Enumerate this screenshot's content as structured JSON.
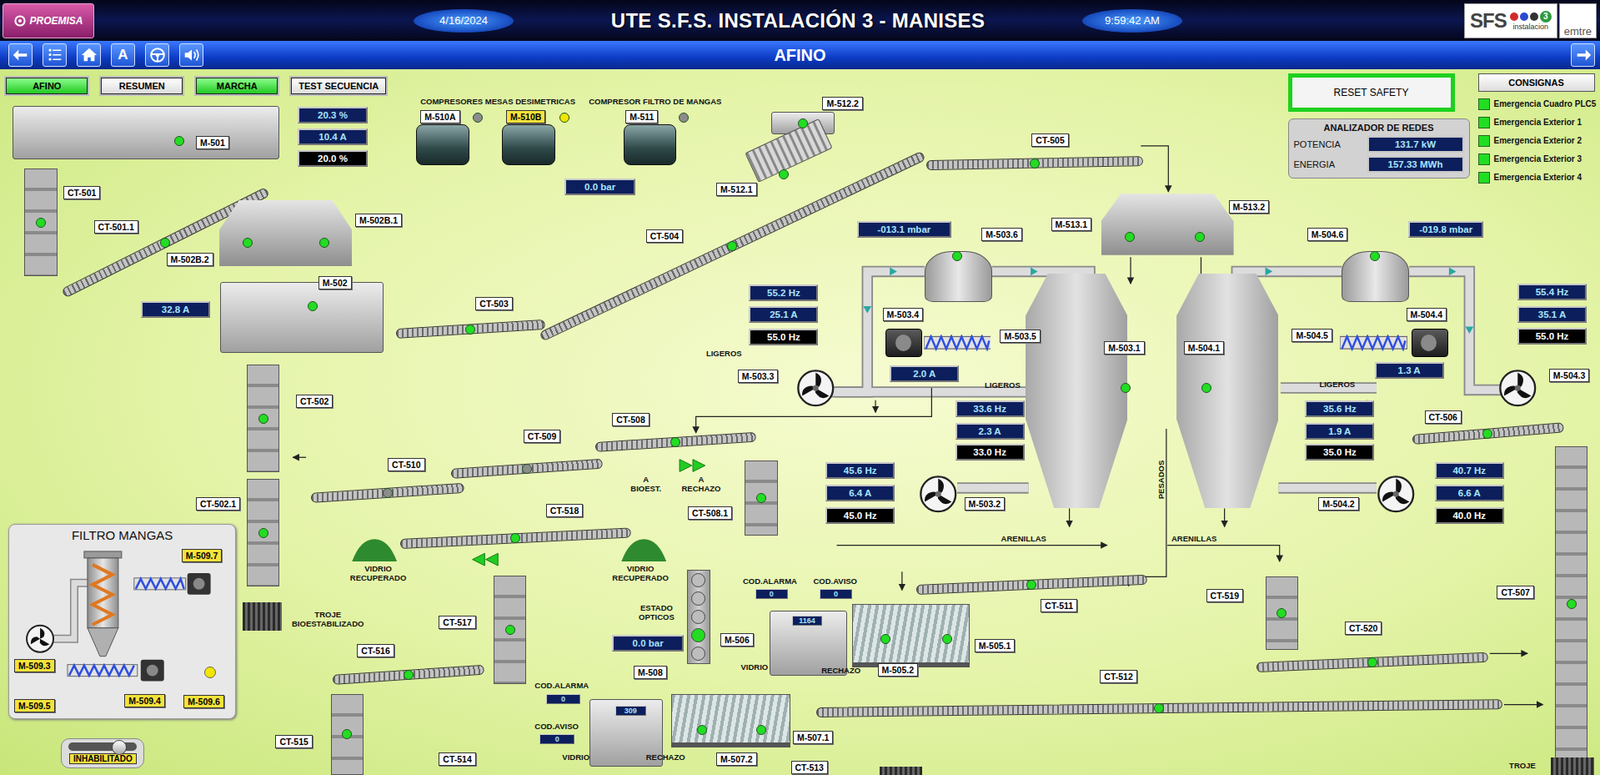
{
  "header": {
    "logo": "PROEMISA",
    "date": "4/16/2024",
    "title": "UTE S.F.S. INSTALACIÓN 3 - MANISES",
    "time": "9:59:42 AM",
    "brand": {
      "name": "SFS",
      "number": "3",
      "caption": "instalacion",
      "partner": "emtre"
    }
  },
  "nav": {
    "key": "A",
    "title": "AFINO"
  },
  "modes": [
    {
      "label": "AFINO",
      "active": true
    },
    {
      "label": "RESUMEN",
      "active": false
    },
    {
      "label": "MARCHA",
      "active": true
    },
    {
      "label": "TEST SECUENCIA",
      "active": false
    }
  ],
  "resetSafety": "RESET SAFETY",
  "setpoints": "CONSIGNAS",
  "emergencies": [
    {
      "label": "Emergencia Cuadro PLC5",
      "color": "#22dd22"
    },
    {
      "label": "Emergencia Exterior 1",
      "color": "#22dd22"
    },
    {
      "label": "Emergencia Exterior 2",
      "color": "#22dd22"
    },
    {
      "label": "Emergencia Exterior 3",
      "color": "#22dd22"
    },
    {
      "label": "Emergencia Exterior 4",
      "color": "#22dd22"
    }
  ],
  "analyzer": {
    "title": "ANALIZADOR DE REDES",
    "rows": [
      {
        "label": "POTENCIA",
        "value": "131.7 kW"
      },
      {
        "label": "ENERGIA",
        "value": "157.33 MWh"
      }
    ]
  },
  "tags": [
    {
      "label": "M-501",
      "warning": false
    },
    {
      "label": "CT-501",
      "warning": false
    },
    {
      "label": "CT-501.1",
      "warning": false
    },
    {
      "label": "M-502B.1",
      "warning": false
    },
    {
      "label": "M-502B.2",
      "warning": false
    },
    {
      "label": "M-502",
      "warning": false
    },
    {
      "label": "CT-503",
      "warning": false
    },
    {
      "label": "CT-504",
      "warning": false
    },
    {
      "label": "M-512.2",
      "warning": false
    },
    {
      "label": "M-512.1",
      "warning": false
    },
    {
      "label": "CT-505",
      "warning": false
    },
    {
      "label": "M-513.1",
      "warning": false
    },
    {
      "label": "M-513.2",
      "warning": false
    },
    {
      "label": "M-503.6",
      "warning": false
    },
    {
      "label": "M-504.6",
      "warning": false
    },
    {
      "label": "M-503.4",
      "warning": false
    },
    {
      "label": "M-503.5",
      "warning": false
    },
    {
      "label": "M-503.3",
      "warning": false
    },
    {
      "label": "M-503.1",
      "warning": false
    },
    {
      "label": "M-504.1",
      "warning": false
    },
    {
      "label": "M-504.5",
      "warning": false
    },
    {
      "label": "M-504.4",
      "warning": false
    },
    {
      "label": "M-504.3",
      "warning": false
    },
    {
      "label": "CT-502",
      "warning": false
    },
    {
      "label": "CT-508",
      "warning": false
    },
    {
      "label": "CT-509",
      "warning": false
    },
    {
      "label": "CT-510",
      "warning": false
    },
    {
      "label": "CT-506",
      "warning": false
    },
    {
      "label": "M-503.2",
      "warning": false
    },
    {
      "label": "M-504.2",
      "warning": false
    },
    {
      "label": "CT-502.1",
      "warning": false
    },
    {
      "label": "CT-508.1",
      "warning": false
    },
    {
      "label": "CT-518",
      "warning": false
    },
    {
      "label": "CT-511",
      "warning": false
    },
    {
      "label": "CT-519",
      "warning": false
    },
    {
      "label": "CT-507",
      "warning": false
    },
    {
      "label": "CT-520",
      "warning": false
    },
    {
      "label": "M-506",
      "warning": false
    },
    {
      "label": "M-505.1",
      "warning": false
    },
    {
      "label": "M-505.2",
      "warning": false
    },
    {
      "label": "M-508",
      "warning": false
    },
    {
      "label": "CT-517",
      "warning": false
    },
    {
      "label": "CT-516",
      "warning": false
    },
    {
      "label": "CT-512",
      "warning": false
    },
    {
      "label": "CT-515",
      "warning": false
    },
    {
      "label": "CT-514",
      "warning": false
    },
    {
      "label": "M-507.1",
      "warning": false
    },
    {
      "label": "M-507.2",
      "warning": false
    },
    {
      "label": "CT-513",
      "warning": false
    },
    {
      "label": "M-510A",
      "warning": false
    },
    {
      "label": "M-510B",
      "warning": true
    },
    {
      "label": "M-511",
      "warning": false
    },
    {
      "label": "M-509.7",
      "warning": true
    },
    {
      "label": "M-509.3",
      "warning": true
    },
    {
      "label": "M-509.5",
      "warning": true
    },
    {
      "label": "M-509.4",
      "warning": true
    },
    {
      "label": "M-509.6",
      "warning": true
    }
  ],
  "labels": [
    {
      "text": "COMPRESORES MESAS DESIMETRICAS",
      "kind": "plain"
    },
    {
      "text": "COMPRESOR FILTRO DE MANGAS",
      "kind": "plain"
    },
    {
      "text": "LIGEROS",
      "kind": "plain"
    },
    {
      "text": "LIGEROS",
      "kind": "plain"
    },
    {
      "text": "LIGEROS",
      "kind": "plain"
    },
    {
      "text": "PESADOS",
      "kind": "vertical"
    },
    {
      "text": "ARENILLAS",
      "kind": "plain"
    },
    {
      "text": "ARENILLAS",
      "kind": "plain"
    },
    {
      "text": "A BIOEST.",
      "kind": "wrap"
    },
    {
      "text": "A RECHAZO",
      "kind": "wrap"
    },
    {
      "text": "VIDRIO RECUPERADO",
      "kind": "wrap"
    },
    {
      "text": "VIDRIO RECUPERADO",
      "kind": "wrap"
    },
    {
      "text": "TROJE BIOESTABILIZADO",
      "kind": "wrap"
    },
    {
      "text": "COD.ALARMA",
      "kind": "plain"
    },
    {
      "text": "COD.AVISO",
      "kind": "plain"
    },
    {
      "text": "ESTADO OPTICOS",
      "kind": "wrap"
    },
    {
      "text": "VIDRIO",
      "kind": "plain"
    },
    {
      "text": "RECHAZO",
      "kind": "plain"
    },
    {
      "text": "COD.ALARMA",
      "kind": "plain"
    },
    {
      "text": "COD.AVISO",
      "kind": "plain"
    },
    {
      "text": "VIDRIO",
      "kind": "plain"
    },
    {
      "text": "RECHAZO",
      "kind": "plain"
    },
    {
      "text": "TROJE",
      "kind": "plain"
    }
  ],
  "readouts": [
    {
      "value": "20.3 %",
      "kind": "measure"
    },
    {
      "value": "10.4 A",
      "kind": "measure"
    },
    {
      "value": "20.0 %",
      "kind": "setpoint"
    },
    {
      "value": "0.0 bar",
      "kind": "measure"
    },
    {
      "value": "32.8 A",
      "kind": "measure"
    },
    {
      "value": "-013.1 mbar",
      "kind": "measure"
    },
    {
      "value": "-019.8 mbar",
      "kind": "measure"
    },
    {
      "value": "55.2 Hz",
      "kind": "measure"
    },
    {
      "value": "25.1 A",
      "kind": "measure"
    },
    {
      "value": "55.0 Hz",
      "kind": "setpoint"
    },
    {
      "value": "2.0 A",
      "kind": "measure"
    },
    {
      "value": "33.6 Hz",
      "kind": "measure"
    },
    {
      "value": "2.3 A",
      "kind": "measure"
    },
    {
      "value": "33.0 Hz",
      "kind": "setpoint"
    },
    {
      "value": "45.6 Hz",
      "kind": "measure"
    },
    {
      "value": "6.4 A",
      "kind": "measure"
    },
    {
      "value": "45.0 Hz",
      "kind": "setpoint"
    },
    {
      "value": "55.4 Hz",
      "kind": "measure"
    },
    {
      "value": "35.1 A",
      "kind": "measure"
    },
    {
      "value": "55.0 Hz",
      "kind": "setpoint"
    },
    {
      "value": "1.3 A",
      "kind": "measure"
    },
    {
      "value": "35.6 Hz",
      "kind": "measure"
    },
    {
      "value": "1.9 A",
      "kind": "measure"
    },
    {
      "value": "35.0 Hz",
      "kind": "setpoint"
    },
    {
      "value": "40.7 Hz",
      "kind": "measure"
    },
    {
      "value": "6.6 A",
      "kind": "measure"
    },
    {
      "value": "40.0 Hz",
      "kind": "setpoint"
    },
    {
      "value": "0.0 bar",
      "kind": "measure"
    },
    {
      "value": "0",
      "kind": "code"
    },
    {
      "value": "0",
      "kind": "code"
    },
    {
      "value": "1164",
      "kind": "code"
    },
    {
      "value": "0",
      "kind": "code"
    },
    {
      "value": "0",
      "kind": "code"
    },
    {
      "value": "309",
      "kind": "code"
    }
  ],
  "equipment": [
    {
      "kind": "conveyor",
      "color": "#22dd22"
    },
    {
      "kind": "conveyor",
      "color": "#22dd22"
    },
    {
      "kind": "conveyor",
      "color": "#22dd22"
    },
    {
      "kind": "conveyor",
      "color": "#22dd22"
    },
    {
      "kind": "conveyor",
      "color": "#22dd22"
    },
    {
      "kind": "conveyor",
      "color": "#8c8c8c"
    },
    {
      "kind": "conveyor",
      "color": "#8c8c8c"
    },
    {
      "kind": "conveyor",
      "color": "#22dd22"
    },
    {
      "kind": "conveyor",
      "color": "#22dd22"
    },
    {
      "kind": "conveyor",
      "color": "#22dd22"
    },
    {
      "kind": "conveyor",
      "color": "#22dd22"
    },
    {
      "kind": "conveyor",
      "color": "#22dd22"
    },
    {
      "kind": "conveyor",
      "color": "#22dd22"
    },
    {
      "kind": "column",
      "color": "#22dd22"
    },
    {
      "kind": "column",
      "color": "#22dd22"
    },
    {
      "kind": "column",
      "color": "#22dd22"
    },
    {
      "kind": "column",
      "color": "#22dd22"
    },
    {
      "kind": "column",
      "color": "#22dd22"
    },
    {
      "kind": "column",
      "color": "#22dd22"
    },
    {
      "kind": "column",
      "color": "#22dd22"
    },
    {
      "kind": "column",
      "color": "#22dd22"
    },
    {
      "kind": "machine",
      "color": "#22dd22"
    },
    {
      "kind": "hopper",
      "color": "#22dd22"
    },
    {
      "kind": "machine",
      "color": "#22dd22"
    },
    {
      "kind": "machine",
      "color": "#22dd22"
    },
    {
      "kind": "screen",
      "color": "#22dd22"
    },
    {
      "kind": "cyclone",
      "color": "#22dd22"
    },
    {
      "kind": "cyclone",
      "color": "#22dd22"
    },
    {
      "kind": "separator",
      "color": "#22dd22"
    },
    {
      "kind": "separator",
      "color": "#22dd22"
    },
    {
      "kind": "hopper",
      "color": "#22dd22"
    },
    {
      "kind": "machine"
    },
    {
      "kind": "table",
      "color": "#22dd22"
    },
    {
      "kind": "machine"
    },
    {
      "kind": "table",
      "color": "#22dd22"
    },
    {
      "kind": "fan"
    },
    {
      "kind": "fan"
    },
    {
      "kind": "fan"
    },
    {
      "kind": "fan"
    },
    {
      "kind": "motor"
    },
    {
      "kind": "motor"
    },
    {
      "kind": "screw"
    },
    {
      "kind": "screw"
    },
    {
      "kind": "compressor",
      "color": "#8c8c8c"
    },
    {
      "kind": "compressor",
      "color": "#f2e600"
    },
    {
      "kind": "compressor",
      "color": "#8c8c8c"
    },
    {
      "kind": "bin"
    },
    {
      "kind": "bin"
    },
    {
      "kind": "bin"
    }
  ],
  "optics": [
    {
      "on": false
    },
    {
      "on": false
    },
    {
      "on": false
    },
    {
      "on": true
    },
    {
      "on": false
    }
  ],
  "filter": {
    "title": "FILTRO MANGAS",
    "color": "#f2e600"
  },
  "switch": {
    "label": "INHABILITADO",
    "on": false
  }
}
